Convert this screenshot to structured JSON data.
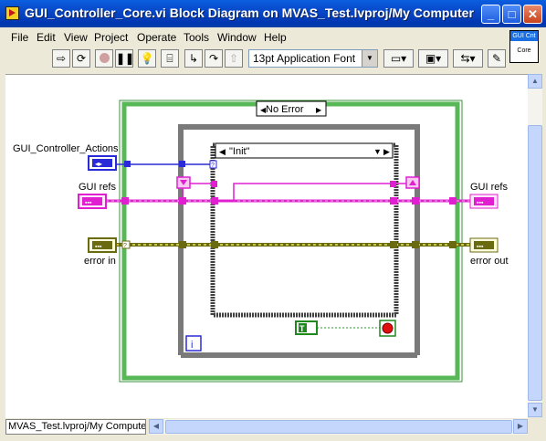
{
  "window": {
    "title": "GUI_Controller_Core.vi Block Diagram on MVAS_Test.lvproj/My Computer",
    "controls": {
      "minimize": "_",
      "maximize": "□",
      "close": "✕"
    }
  },
  "menu": [
    "File",
    "Edit",
    "View",
    "Project",
    "Operate",
    "Tools",
    "Window",
    "Help"
  ],
  "toolbar": {
    "icons": [
      "run-arrow-icon",
      "run-continuously-icon",
      "abort-icon",
      "pause-icon",
      "highlight-execution-icon",
      "retain-wire-values-icon",
      "step-into-icon",
      "step-over-icon",
      "step-out-icon",
      "align-icon",
      "distribute-icon",
      "reorder-icon",
      "cleanup-icon"
    ],
    "font": "13pt Application Font"
  },
  "vi_icon": {
    "line1": "GUI Cnt",
    "line2": "Core"
  },
  "diagram": {
    "error_case_selector": "No Error",
    "state_case_selector": "\"Init\"",
    "terminals": {
      "actions_in": "GUI_Controller_Actions",
      "gui_refs_in": "GUI refs",
      "gui_refs_out": "GUI refs",
      "error_in": "error in",
      "error_out": "error out"
    },
    "loop_iteration_label": "i",
    "boolean_constant": "T"
  },
  "status": {
    "project_path": "MVAS_Test.lvproj/My Computer"
  }
}
